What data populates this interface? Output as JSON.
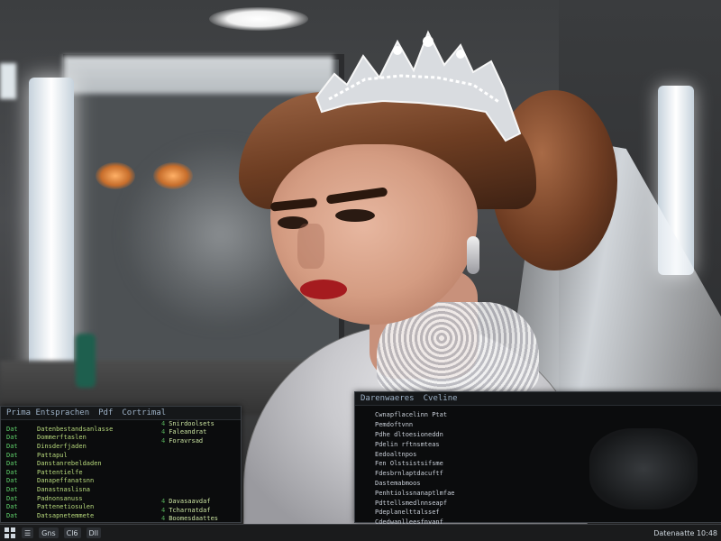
{
  "left_window": {
    "title_a": "Prima Entsprachen",
    "title_b": "Pdf",
    "title_c": "Cortrimal",
    "rows": [
      {
        "num": "Dat",
        "name": "Datenbestandsanlasse"
      },
      {
        "num": "Dat",
        "name": "Dommerftaslen"
      },
      {
        "num": "Dat",
        "name": "Dinsderfjaden"
      },
      {
        "num": "Dat",
        "name": "Pattapul"
      },
      {
        "num": "Dat",
        "name": "Danstanrebeldaden"
      },
      {
        "num": "Dat",
        "name": "Pattentielfe"
      },
      {
        "num": "Dat",
        "name": "Danapeffanatsnn"
      },
      {
        "num": "Dat",
        "name": "Danastnaslisna"
      },
      {
        "num": "Dat",
        "name": "Padnonsanuss"
      },
      {
        "num": "Dat",
        "name": "Pattenetiosulen"
      },
      {
        "num": "Dat",
        "name": "Datsapnetemmete"
      }
    ],
    "stats": [
      {
        "text": "Snirdoolsets",
        "blank_before": 0
      },
      {
        "text": "Faleandrat",
        "blank_before": 0
      },
      {
        "text": "Foravrsad",
        "blank_before": 0
      },
      {
        "text": "Davasaavdaf",
        "blank_before": 6
      },
      {
        "text": "Tcharnatdaf",
        "blank_before": 0
      },
      {
        "text": "Boomesdaattes",
        "blank_before": 0
      },
      {
        "text": "Dasdsrplattes",
        "blank_before": 0
      }
    ],
    "colors": {
      "bg": "#0b0c0d",
      "num": "#5fd06a",
      "name": "#b7d97c"
    }
  },
  "right_window": {
    "title_a": "Darenwaeres",
    "title_b": "Cveline",
    "items": [
      "Cwnapflacelinn Ptat",
      "Pemdoftvnn",
      "Pdhe dltoesioneddn",
      "Pdelin rftnsmteas",
      "Eedoaltnpos",
      "Fen Olstsistsifsme",
      "Fdesbrnlaptdacuftf",
      "Dastemabmoos",
      "Penhtiolssnanaptlmfae",
      "Pdttellsmedlnnseapf",
      "Pdeplanelttalssef",
      "Cdedwanlleesfnyanf"
    ]
  },
  "taskbar": {
    "start_icon": "start-icon",
    "buttons": [
      "☰",
      "Gns",
      "Cl6",
      "Dll"
    ],
    "clock": "Datenaatte 10:48"
  }
}
